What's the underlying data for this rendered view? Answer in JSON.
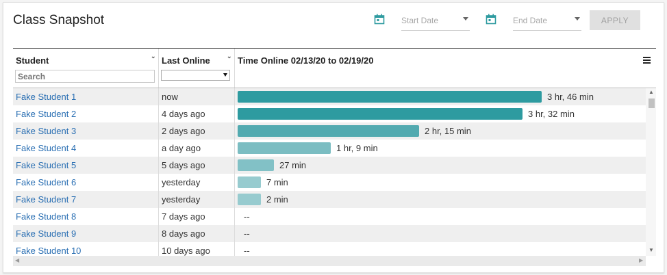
{
  "header": {
    "title": "Class Snapshot",
    "start_date_placeholder": "Start Date",
    "end_date_placeholder": "End Date",
    "apply_label": "APPLY"
  },
  "colors": {
    "accent": "#2e9ba0",
    "link": "#2a6fb3"
  },
  "icons": {
    "calendar": "calendar-icon",
    "menu": "hamburger-menu-icon"
  },
  "table": {
    "columns": {
      "student": "Student",
      "last_online": "Last Online",
      "time_online": "Time Online 02/13/20 to 02/19/20"
    },
    "search_placeholder": "Search",
    "rows": [
      {
        "student": "Fake Student 1",
        "last_online": "now",
        "time_text": "3 hr, 46 min",
        "minutes": 226
      },
      {
        "student": "Fake Student 2",
        "last_online": "4 days ago",
        "time_text": "3 hr, 32 min",
        "minutes": 212
      },
      {
        "student": "Fake Student 3",
        "last_online": "2 days ago",
        "time_text": "2 hr, 15 min",
        "minutes": 135
      },
      {
        "student": "Fake Student 4",
        "last_online": "a day ago",
        "time_text": "1 hr, 9 min",
        "minutes": 69
      },
      {
        "student": "Fake Student 5",
        "last_online": "5 days ago",
        "time_text": "27 min",
        "minutes": 27
      },
      {
        "student": "Fake Student 6",
        "last_online": "yesterday",
        "time_text": "7 min",
        "minutes": 7
      },
      {
        "student": "Fake Student 7",
        "last_online": "yesterday",
        "time_text": "2 min",
        "minutes": 2
      },
      {
        "student": "Fake Student 8",
        "last_online": "7 days ago",
        "time_text": "--",
        "minutes": 0
      },
      {
        "student": "Fake Student 9",
        "last_online": "8 days ago",
        "time_text": "--",
        "minutes": 0
      },
      {
        "student": "Fake Student 10",
        "last_online": "10 days ago",
        "time_text": "--",
        "minutes": 0
      }
    ]
  }
}
